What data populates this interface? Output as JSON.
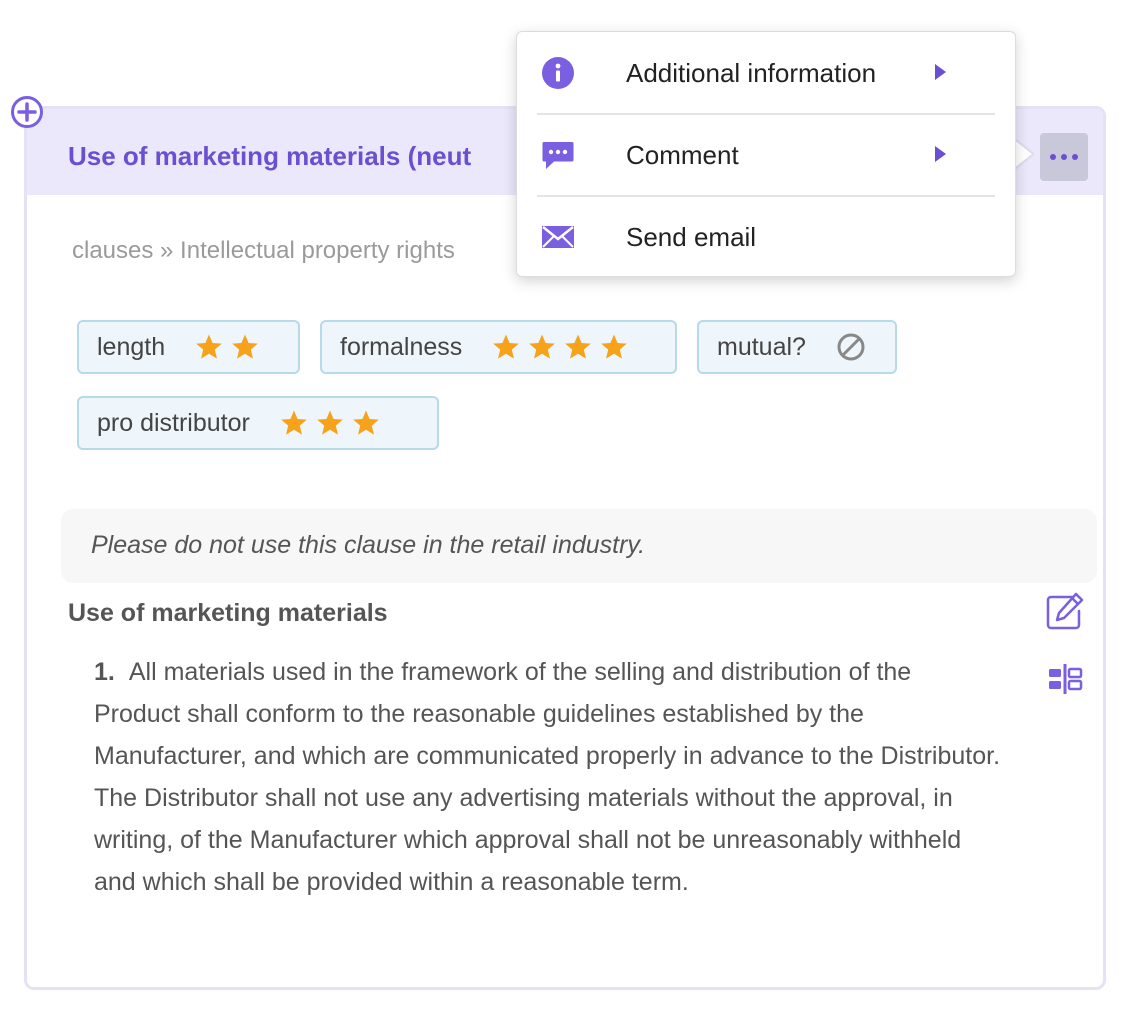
{
  "card": {
    "title": "Use of marketing materials (neut",
    "breadcrumb": "clauses » Intellectual property rights"
  },
  "tags": [
    {
      "label": "length",
      "stars": 2
    },
    {
      "label": "formalness",
      "stars": 4
    },
    {
      "label": "mutual?",
      "stars": 0,
      "icon": "not-allowed-icon"
    },
    {
      "label": "pro distributor",
      "stars": 3
    }
  ],
  "note": "Please do not use this clause in the retail industry.",
  "section": {
    "title": "Use of marketing materials",
    "clause_number": "1.",
    "clause_text": "All materials used in the framework of the selling and distribution of the Product shall conform to the reasonable guidelines established by the Manufacturer, and which are communicated properly in advance to the Distributor. The Distributor shall not use any advertising materials without the approval, in writing, of the Manufacturer which approval shall not be unreasonably withheld and which shall be provided within a reasonable term."
  },
  "menu": {
    "items": [
      {
        "label": "Additional information",
        "icon": "info-icon",
        "submenu": true
      },
      {
        "label": "Comment",
        "icon": "comment-icon",
        "submenu": true
      },
      {
        "label": "Send email",
        "icon": "envelope-icon",
        "submenu": false
      }
    ]
  },
  "colors": {
    "accent": "#6a4fd0",
    "header_bg": "#ebe8fb",
    "star": "#f7a21b",
    "tag_border": "#b7d9e8",
    "tag_bg": "#eef6fb"
  }
}
